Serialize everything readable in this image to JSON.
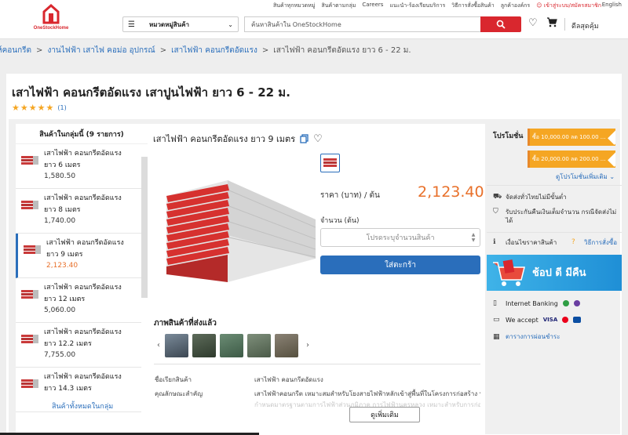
{
  "toplinks": {
    "items": [
      "สินค้าทุกหมวดหมู่",
      "สินค้าตามกลุ่ม",
      "Careers",
      "แนะนำ-ร้องเรียนบริการ",
      "วิธีการสั่งซื้อสินค้า",
      "ลูกค้าองค์กร"
    ],
    "user": "เข้าสู่ระบบ/สมัครสมาชิก",
    "lang": "English"
  },
  "header": {
    "logo_text": "OneStockHome",
    "category_label": "หมวดหมู่สินค้า",
    "search_placeholder": "ค้นหาสินค้าใน OneStockHome",
    "latest": "ดีลสุดคุ้ม",
    "icons": [
      "menu-icon",
      "chevron-down-icon",
      "search-icon",
      "heart-icon",
      "cart-icon"
    ]
  },
  "breadcrumb": [
    "ห์คอนกรีต",
    "งานไฟฟ้า เสาไฟ คอม่อ อุปกรณ์",
    "เสาไฟฟ้า คอนกรีตอัดแรง",
    "เสาไฟฟ้า คอนกรีตอัดแรง ยาว 6 - 22 ม."
  ],
  "product": {
    "title": "เสาไฟฟ้า คอนกรีตอัดแรง เสาปูนไฟฟ้า ยาว 6 - 22 ม.",
    "stars": 5,
    "review_count": "(1)"
  },
  "group_list": {
    "heading": "สินค้าในกลุ่มนี้ (9 รายการ)",
    "items": [
      {
        "name": "เสาไฟฟ้า คอนกรีตอัดแรง ยาว 6 เมตร",
        "price": "1,580.50"
      },
      {
        "name": "เสาไฟฟ้า คอนกรีตอัดแรง ยาว 8 เมตร",
        "price": "1,740.00"
      },
      {
        "name": "เสาไฟฟ้า คอนกรีตอัดแรง ยาว 9 เมตร",
        "price": "2,123.40"
      },
      {
        "name": "เสาไฟฟ้า คอนกรีตอัดแรง ยาว 12 เมตร",
        "price": "5,060.00"
      },
      {
        "name": "เสาไฟฟ้า คอนกรีตอัดแรง ยาว 12.2 เมตร",
        "price": "7,755.00"
      },
      {
        "name": "เสาไฟฟ้า คอนกรีตอัดแรง ยาว 14.3 เมตร",
        "price": ""
      }
    ],
    "selected_index": 2,
    "view_all": "สินค้าทั้งหมดในกลุ่ม"
  },
  "detail": {
    "title": "เสาไฟฟ้า คอนกรีตอัดแรง ยาว 9 เมตร",
    "price_label": "ราคา (บาท) / ต้น",
    "price": "2,123.40",
    "qty_label": "จำนวน (ต้น)",
    "qty_placeholder": "โปรดระบุจำนวนสินค้า",
    "add_to_cart": "ใส่ตะกร้า",
    "delivered_title": "ภาพสินค้าที่ส่งแล้ว",
    "spec": [
      {
        "key": "ชื่อเรียกสินค้า",
        "value": "เสาไฟฟ้า คอนกรีตอัดแรง"
      },
      {
        "key": "คุณลักษณะสำคัญ",
        "value": "เสาไฟฟ้าคอนกรีต เหมาะสมสำหรับโยงสายไฟฟ้าหลักเข้าสู่พื้นที่ในโครงการก่อสร้าง บ้านเรือน อาคารต่างๆ ได้มาตรฐานตามข้อ"
      }
    ],
    "spec_faded": "กำหนดมาตรฐานตามการไฟฟ้าส่วนภูมิภาค การไฟฟ้านครหลวง เหมาะสำหรับการก่อสร้างระบบไฟฟ้าในพื้นที่ต่างๆ",
    "more": "ดูเพิ่มเติม"
  },
  "promo": {
    "label": "โปรโมชั่น",
    "coupons": [
      "ซื้อ 10,000.00 ลด 100.00 ...",
      "ซื้อ 20,000.00 ลด 200.00 ..."
    ],
    "more": "ดูโปรโมชั่นเพิ่มเติม",
    "shipping": "จัดส่งทั่วไทยไม่มีขั้นต่ำ",
    "refund": "รับประกันคืนเงินเต็มจำนวน กรณีจัดส่งไม่ได้",
    "condition": "เงื่อนไขราคาสินค้า",
    "howto": "วิธีการสั่งซื้อ",
    "banner": "ช้อป ดี มีคืน",
    "internet_banking": "Internet Banking",
    "we_accept": "We accept",
    "installment": "ตารางการผ่อนชำระ"
  },
  "colors": {
    "brand_red": "#d9272e",
    "link_blue": "#2a6ebb",
    "price_orange": "#e8702a",
    "coupon_orange": "#f5a623"
  }
}
